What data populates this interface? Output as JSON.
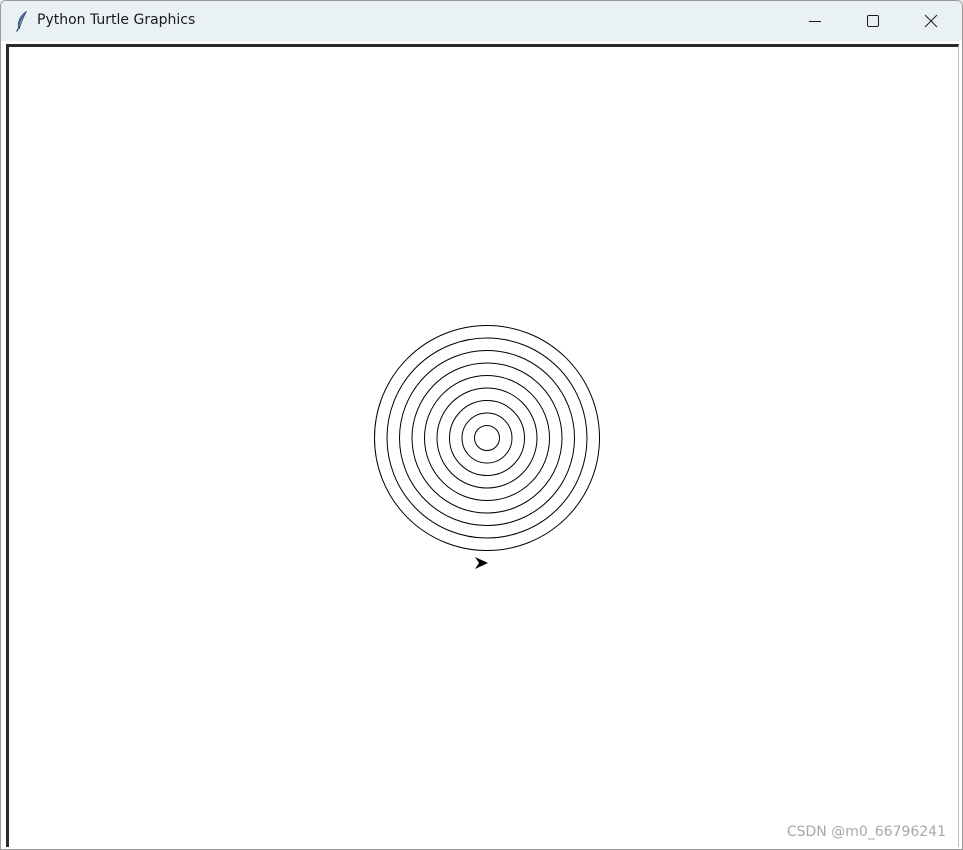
{
  "window": {
    "title": "Python Turtle Graphics",
    "app_icon": "feather-icon",
    "controls": {
      "minimize_icon": "minimize-icon",
      "maximize_icon": "maximize-icon",
      "close_icon": "close-icon"
    }
  },
  "canvas": {
    "background_color": "#ffffff",
    "pen_color": "#000000",
    "concentric_circles": 9,
    "turtle_shape": "classic-arrow-icon",
    "turtle_heading": "right"
  },
  "watermark": {
    "text": "CSDN @m0_66796241"
  }
}
